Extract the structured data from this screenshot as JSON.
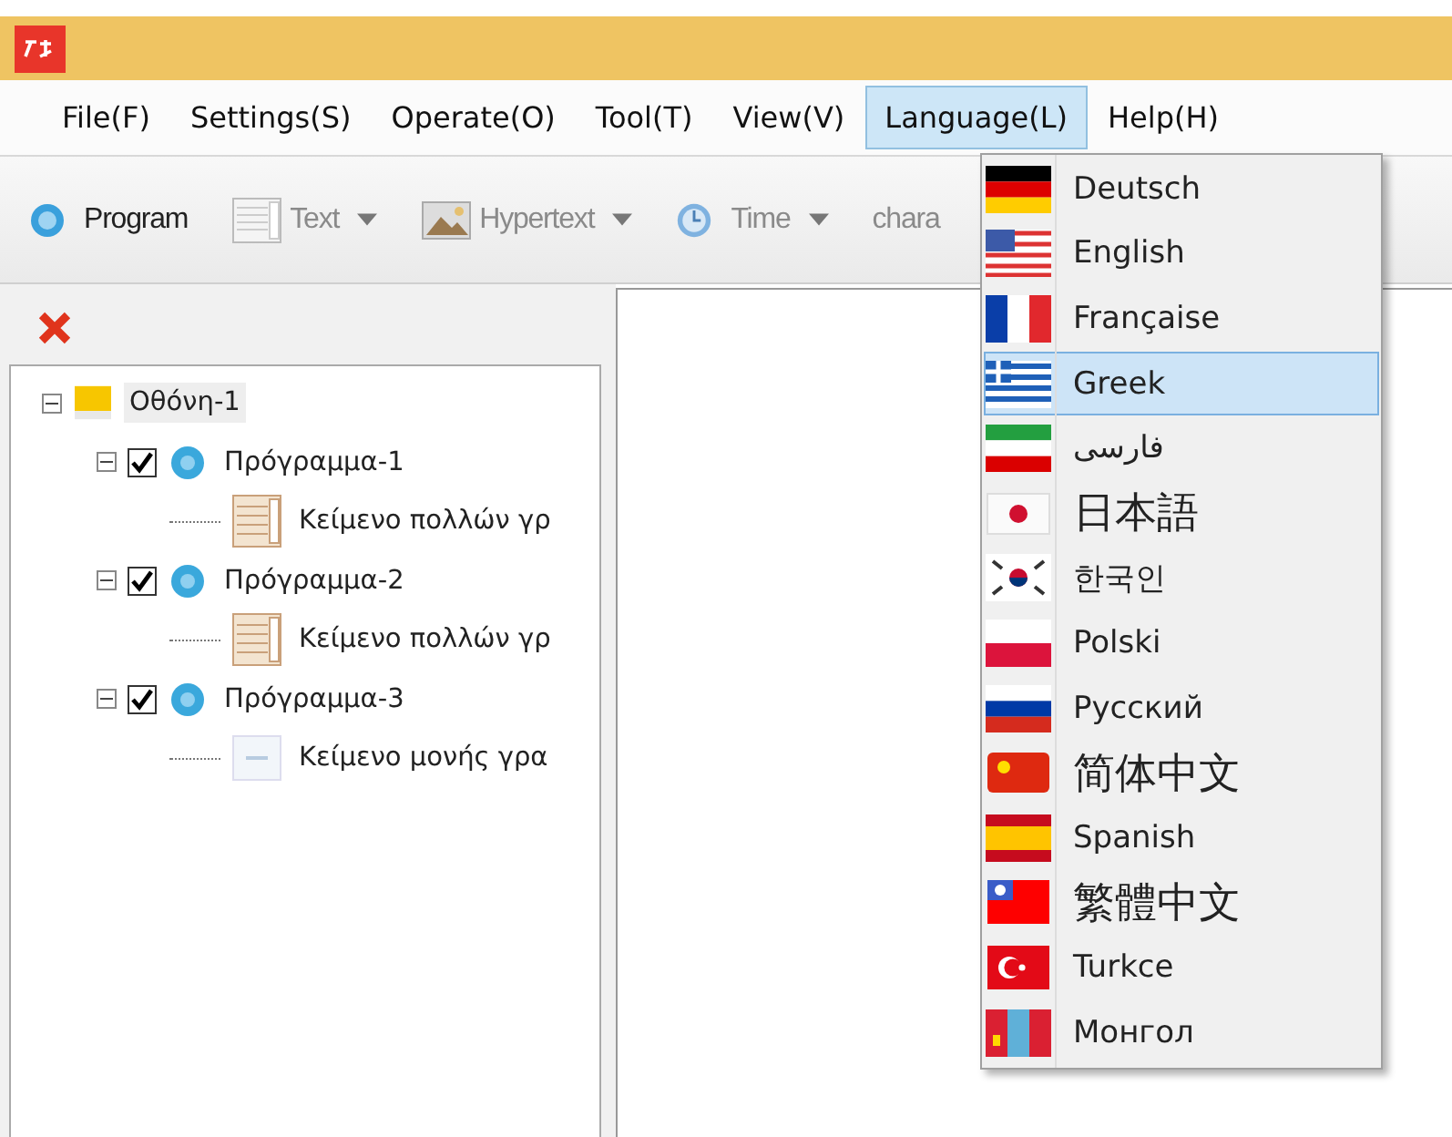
{
  "menu_bar": [
    {
      "label": "File(F)",
      "selected": false
    },
    {
      "label": "Settings(S)",
      "selected": false
    },
    {
      "label": "Operate(O)",
      "selected": false
    },
    {
      "label": "Tool(T)",
      "selected": false
    },
    {
      "label": "View(V)",
      "selected": false
    },
    {
      "label": "Language(L)",
      "selected": true
    },
    {
      "label": "Help(H)",
      "selected": false
    }
  ],
  "toolbar": [
    {
      "kind": "program",
      "label": "Program",
      "disabled": false,
      "dropdown": false
    },
    {
      "kind": "text",
      "label": "Text",
      "disabled": true,
      "dropdown": true
    },
    {
      "kind": "hypertext",
      "label": "Hypertext",
      "disabled": true,
      "dropdown": true
    },
    {
      "kind": "time",
      "label": "Time",
      "disabled": true,
      "dropdown": true
    },
    {
      "kind": "plain",
      "label": "chara",
      "disabled": true,
      "dropdown": false
    }
  ],
  "tree": [
    {
      "kind": "screen",
      "label": "Οθόνη-1",
      "selected": true,
      "expanded": true,
      "children": [
        {
          "kind": "program",
          "label": "Πρόγραμμα-1",
          "checked": true,
          "selected": false,
          "expanded": true,
          "children": [
            {
              "kind": "multiline",
              "label": "Κείμενο πολλών γρ",
              "selected": false
            }
          ]
        },
        {
          "kind": "program",
          "label": "Πρόγραμμα-2",
          "checked": true,
          "selected": false,
          "expanded": true,
          "children": [
            {
              "kind": "multiline",
              "label": "Κείμενο πολλών γρ",
              "selected": false
            }
          ]
        },
        {
          "kind": "program",
          "label": "Πρόγραμμα-3",
          "checked": true,
          "selected": false,
          "expanded": true,
          "children": [
            {
              "kind": "single",
              "label": "Κείμενο μονής γρα",
              "selected": false
            }
          ]
        }
      ]
    }
  ],
  "language_menu": [
    {
      "label": "Deutsch",
      "selected": false,
      "large": false
    },
    {
      "label": "English",
      "selected": false,
      "large": false
    },
    {
      "label": "Française",
      "selected": false,
      "large": false
    },
    {
      "label": "Greek",
      "selected": true,
      "large": false
    },
    {
      "label": "فارسی",
      "selected": false,
      "large": false
    },
    {
      "label": "日本語",
      "selected": false,
      "large": true
    },
    {
      "label": "한국인",
      "selected": false,
      "large": false
    },
    {
      "label": "Polski",
      "selected": false,
      "large": false
    },
    {
      "label": "Русский",
      "selected": false,
      "large": false
    },
    {
      "label": "简体中文",
      "selected": false,
      "large": true
    },
    {
      "label": "Spanish",
      "selected": false,
      "large": false
    },
    {
      "label": "繁體中文",
      "selected": false,
      "large": true
    },
    {
      "label": "Turkce",
      "selected": false,
      "large": false
    },
    {
      "label": "Монгол",
      "selected": false,
      "large": false
    }
  ]
}
